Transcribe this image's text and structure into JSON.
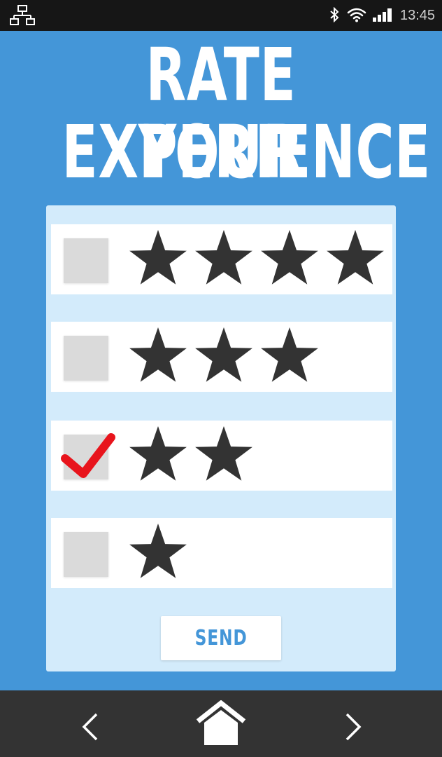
{
  "status_bar": {
    "time": "13:45",
    "icons": [
      "network-icon",
      "bluetooth-icon",
      "wifi-icon",
      "signal-icon"
    ]
  },
  "title": {
    "line1": "RATE YOUR",
    "line2": "EXPERIENCE"
  },
  "rating_options": [
    {
      "stars": 4,
      "checked": false
    },
    {
      "stars": 3,
      "checked": false
    },
    {
      "stars": 2,
      "checked": true
    },
    {
      "stars": 1,
      "checked": false
    }
  ],
  "send_label": "SEND",
  "nav_bar": {
    "icons": [
      "back-icon",
      "home-icon",
      "forward-icon"
    ]
  },
  "colors": {
    "background": "#4496d8",
    "card": "#d3ebfb",
    "star": "#333333",
    "check": "#e8141c",
    "status_bar": "#161616",
    "nav_bar": "#333333"
  }
}
